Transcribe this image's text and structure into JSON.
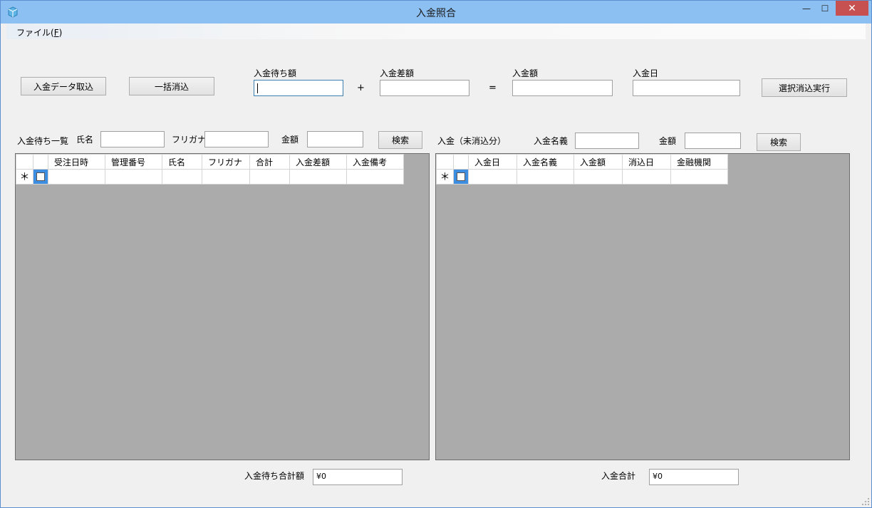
{
  "window": {
    "title": "入金照合",
    "min_glyph": "—",
    "max_glyph": "☐",
    "close_glyph": "✕"
  },
  "menu": {
    "file_prefix": "ファイル(",
    "file_accel": "F",
    "file_suffix": ")"
  },
  "toolbar": {
    "import_label": "入金データ取込",
    "bulk_clear_label": "一括消込",
    "pending_amount_label": "入金待ち額",
    "plus": "+",
    "diff_amount_label": "入金差額",
    "equals": "=",
    "deposit_amount_label": "入金額",
    "deposit_date_label": "入金日",
    "execute_label": "選択消込実行",
    "pending_amount_value": "",
    "diff_amount_value": "",
    "deposit_amount_value": "",
    "deposit_date_value": ""
  },
  "left_search": {
    "title": "入金待ち一覧",
    "name_label": "氏名",
    "kana_label": "フリガナ",
    "amount_label": "金額",
    "search_label": "検索",
    "name_value": "",
    "kana_value": "",
    "amount_value": ""
  },
  "right_search": {
    "title": "入金（未消込分）",
    "payer_label": "入金名義",
    "amount_label": "金額",
    "search_label": "検索",
    "payer_value": "",
    "amount_value": ""
  },
  "left_grid": {
    "columns": [
      "受注日時",
      "管理番号",
      "氏名",
      "フリガナ",
      "合計",
      "入金差額",
      "入金備考"
    ],
    "new_row_marker": "＊"
  },
  "right_grid": {
    "columns": [
      "入金日",
      "入金名義",
      "入金額",
      "消込日",
      "金融機関"
    ],
    "new_row_marker": "＊"
  },
  "footer": {
    "pending_total_label": "入金待ち合計額",
    "pending_total_value": "¥0",
    "deposit_total_label": "入金合計",
    "deposit_total_value": "¥0"
  },
  "colors": {
    "titlebar": "#8cc0f3",
    "close_button": "#c75050",
    "grid_background": "#ababab",
    "selected_cell": "#3d8ee0"
  }
}
